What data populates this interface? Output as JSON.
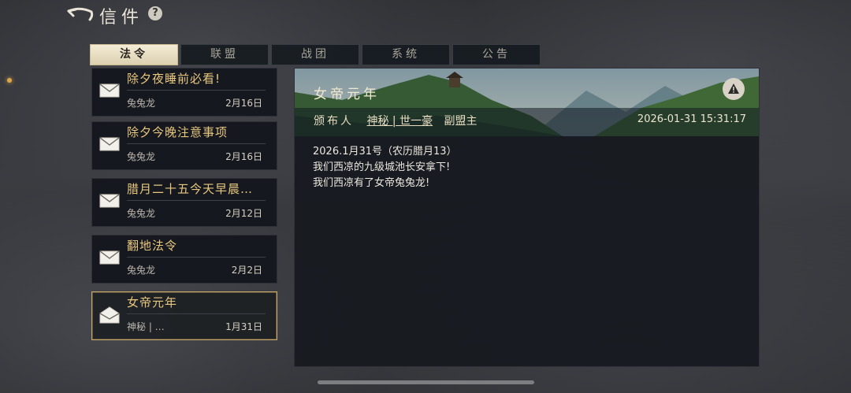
{
  "header": {
    "title": "信件",
    "help_label": "?"
  },
  "tabs": [
    {
      "label": "法令",
      "active": true
    },
    {
      "label": "联盟",
      "active": false
    },
    {
      "label": "战团",
      "active": false
    },
    {
      "label": "系统",
      "active": false
    },
    {
      "label": "公告",
      "active": false
    }
  ],
  "mails": [
    {
      "subject": "除夕夜睡前必看!",
      "sender": "兔兔龙",
      "date": "2月16日",
      "selected": false
    },
    {
      "subject": "除夕今晚注意事项",
      "sender": "兔兔龙",
      "date": "2月16日",
      "selected": false
    },
    {
      "subject": "腊月二十五今天早晨…",
      "sender": "兔兔龙",
      "date": "2月12日",
      "selected": false
    },
    {
      "subject": "翻地法令",
      "sender": "兔兔龙",
      "date": "2月2日",
      "selected": false
    },
    {
      "subject": "女帝元年",
      "sender": "神秘 | …",
      "date": "1月31日",
      "selected": true
    }
  ],
  "detail": {
    "title": "女帝元年",
    "issuer_label": "颁布人",
    "issuer_name": "神秘 | 世一豪",
    "issuer_role": "副盟主",
    "timestamp": "2026-01-31 15:31:17",
    "body": [
      "2026.1月31号（农历腊月13）",
      "我们西凉的九级城池长安拿下!",
      "我们西凉有了女帝兔兔龙!"
    ]
  },
  "colors": {
    "accent_gold": "#e8c77e",
    "selected_border": "#c8a96a",
    "active_tab": "#f4ecd6"
  }
}
